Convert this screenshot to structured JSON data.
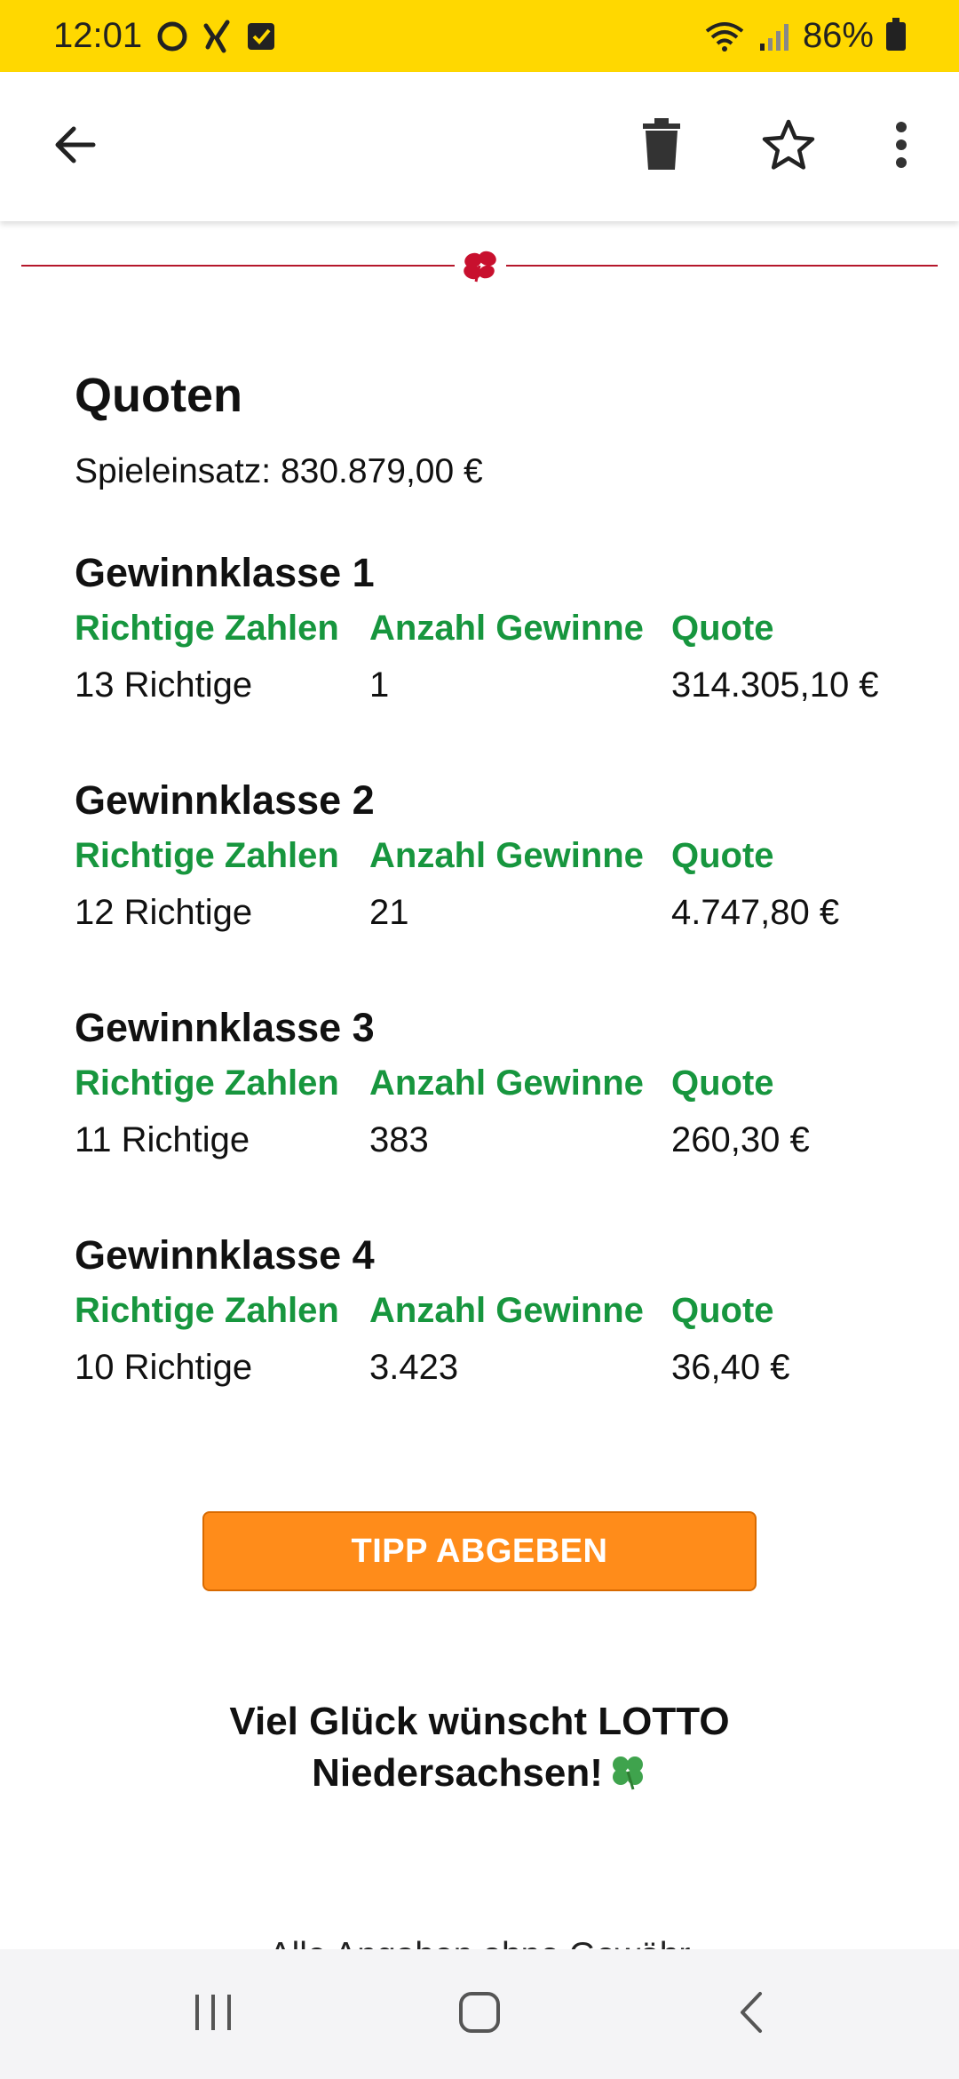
{
  "status_bar": {
    "time": "12:01",
    "battery": "86%",
    "icons": [
      "circle-icon",
      "xing-icon",
      "checkbox-icon",
      "wifi-icon",
      "signal-icon",
      "battery-icon"
    ]
  },
  "app_bar": {
    "icons": [
      "back-arrow-icon",
      "trash-icon",
      "star-outline-icon",
      "more-vert-icon"
    ]
  },
  "content": {
    "title": "Quoten",
    "stake": "Spieleinsatz: 830.879,00 €",
    "classes": [
      {
        "name": "Gewinnklasse 1",
        "header_correct": "Richtige Zahlen",
        "header_count": "Anzahl Gewinne",
        "header_quote": "Quote",
        "correct": "13 Richtige",
        "count": "1",
        "quote": "314.305,10 €"
      },
      {
        "name": "Gewinnklasse 2",
        "header_correct": "Richtige Zahlen",
        "header_count": "Anzahl Gewinne",
        "header_quote": "Quote",
        "correct": "12 Richtige",
        "count": "21",
        "quote": "4.747,80 €"
      },
      {
        "name": "Gewinnklasse 3",
        "header_correct": "Richtige Zahlen",
        "header_count": "Anzahl Gewinne",
        "header_quote": "Quote",
        "correct": "11 Richtige",
        "count": "383",
        "quote": "260,30 €"
      },
      {
        "name": "Gewinnklasse 4",
        "header_correct": "Richtige Zahlen",
        "header_count": "Anzahl Gewinne",
        "header_quote": "Quote",
        "correct": "10 Richtige",
        "count": "3.423",
        "quote": "36,40 €"
      }
    ],
    "cta_label": "TIPP ABGEBEN",
    "wish_line1": "Viel Glück wünscht LOTTO",
    "wish_line2": "Niedersachsen!",
    "disclaimer": "Alle Angaben ohne Gewähr"
  },
  "colors": {
    "status_bar": "#FFD800",
    "accent_green": "#17963E",
    "cta_orange": "#FF8C1A",
    "divider_red": "#B5172B"
  },
  "nav_bar": {
    "icons": [
      "recent-apps-icon",
      "home-icon",
      "back-icon"
    ]
  }
}
